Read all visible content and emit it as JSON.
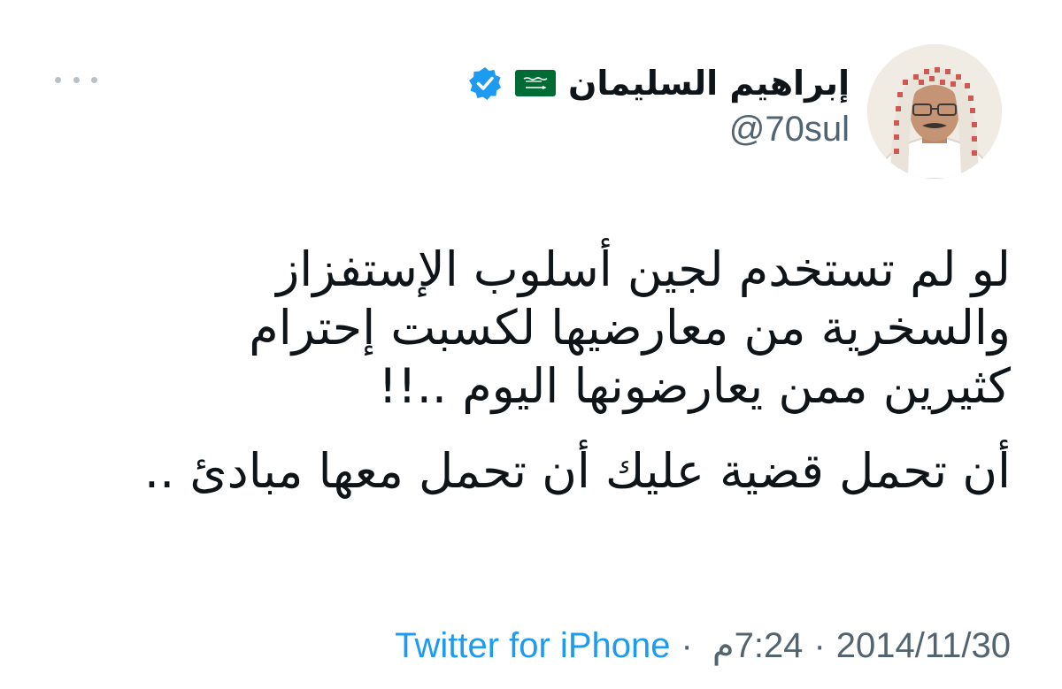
{
  "author": {
    "display_name": "إبراهيم السليمان",
    "handle": "@70sul",
    "verified": true,
    "avatar_icon": "profile-photo",
    "flag_icon": "saudi-flag-icon"
  },
  "tweet": {
    "paragraphs": [
      [
        "لو لم تستخدم لجين أسلوب الإستفزاز",
        "والسخرية من معارضيها لكسبت إحترام",
        "كثيرين ممن يعارضونها اليوم ..!!"
      ],
      [
        "أن تحمل قضية عليك أن تحمل معها مبادئ .."
      ]
    ]
  },
  "meta": {
    "time": "7:24",
    "ampm": "م",
    "date": "2014/11/30",
    "source": "Twitter for iPhone",
    "separator": "·"
  },
  "colors": {
    "text_primary": "#0f1419",
    "text_secondary": "#536471",
    "link": "#1d9bf0",
    "verified": "#1d9bf0",
    "flag_green": "#006c35"
  }
}
